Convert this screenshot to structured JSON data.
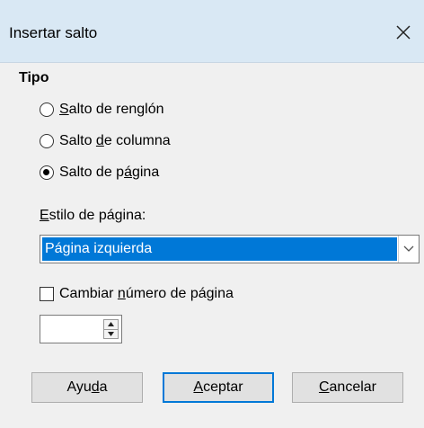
{
  "window": {
    "title": "Insertar salto",
    "close_icon": "close-icon"
  },
  "tipo": {
    "heading": "Tipo",
    "options": [
      {
        "pre": "",
        "u": "S",
        "post": "alto de renglón",
        "checked": false
      },
      {
        "pre": "Salto ",
        "u": "d",
        "post": "e columna",
        "checked": false
      },
      {
        "pre": "Salto de p",
        "u": "á",
        "post": "gina",
        "checked": true
      }
    ]
  },
  "page_style": {
    "label_u": "E",
    "label_rest": "stilo de página:",
    "selected": "Página izquierda",
    "arrow_icon": "chevron-down-icon"
  },
  "change_number": {
    "label_pre": "Cambiar ",
    "label_u": "n",
    "label_post": "úmero de página",
    "checked": false,
    "value": ""
  },
  "buttons": {
    "help": {
      "pre": "Ayu",
      "u": "d",
      "post": "a"
    },
    "ok": {
      "pre": "",
      "u": "A",
      "post": "ceptar"
    },
    "cancel": {
      "pre": "",
      "u": "C",
      "post": "ancelar"
    }
  },
  "colors": {
    "titlebar": "#d9e8f4",
    "selection": "#0078d7",
    "background": "#f0f0f0"
  }
}
